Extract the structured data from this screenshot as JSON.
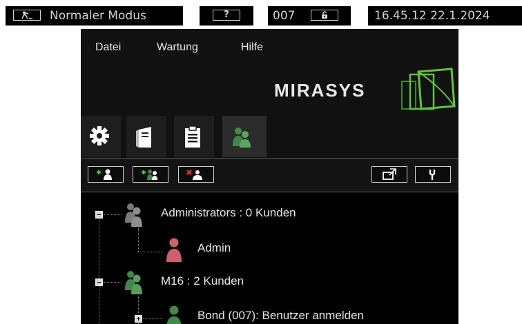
{
  "statusbar": {
    "mode_label": "Normaler Modus",
    "help_label": "?",
    "user_id": "007",
    "lock_label": "",
    "datetime": "16.45.12 22.1.2024"
  },
  "menu": {
    "items": [
      "Datei",
      "Wartung",
      "Hilfe"
    ]
  },
  "logo": {
    "text": "MIRASYS",
    "accent_color": "#5ec63a"
  },
  "tabs": [
    {
      "icon": "gear-icon",
      "active": false
    },
    {
      "icon": "server-icon",
      "active": false
    },
    {
      "icon": "clipboard-icon",
      "active": false
    },
    {
      "icon": "users-icon",
      "active": true
    }
  ],
  "toolbar": {
    "buttons": [
      "add-user",
      "add-group",
      "delete-user",
      "export",
      "properties"
    ]
  },
  "tree": {
    "groups": [
      {
        "label": "Administrators : 0 Kunden",
        "icon_color": "#7a7a7a",
        "children": [
          {
            "label": "Admin",
            "icon_color": "#d0606a"
          }
        ]
      },
      {
        "label": "M16 : 2 Kunden",
        "icon_color": "#3f8a48",
        "children": [
          {
            "label": "Bond (007): Benutzer anmelden",
            "icon_color": "#3f8a48"
          }
        ]
      }
    ]
  }
}
